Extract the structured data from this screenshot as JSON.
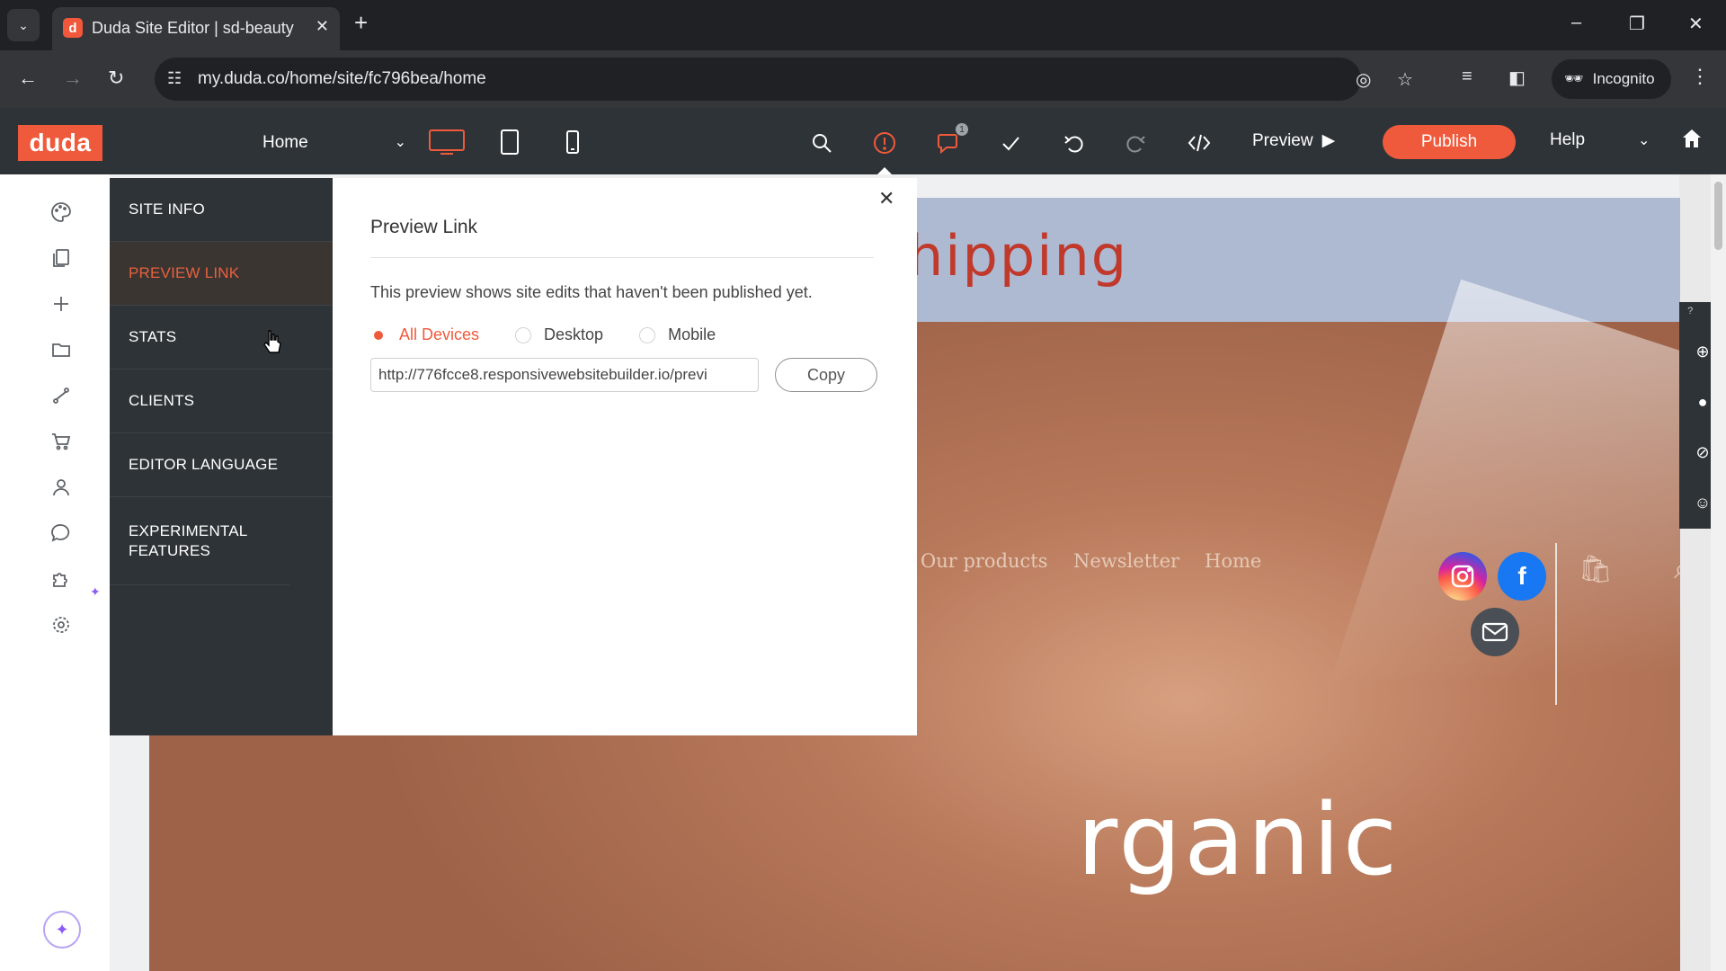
{
  "browser": {
    "tab_title": "Duda Site Editor | sd-beauty",
    "url": "my.duda.co/home/site/fc796bea/home",
    "profile_label": "Incognito"
  },
  "editor": {
    "page_selector": "Home",
    "preview_label": "Preview",
    "publish_label": "Publish",
    "help_label": "Help",
    "notification_count": "1",
    "accent_color": "#f05a3c"
  },
  "settings_menu": {
    "items": [
      {
        "label": "SITE INFO"
      },
      {
        "label": "PREVIEW LINK"
      },
      {
        "label": "STATS"
      },
      {
        "label": "CLIENTS"
      },
      {
        "label": "EDITOR LANGUAGE"
      },
      {
        "label": "EXPERIMENTAL FEATURES"
      }
    ],
    "active_item": "PREVIEW LINK"
  },
  "preview_panel": {
    "title": "Preview Link",
    "description": "This preview shows site edits that haven't been published yet.",
    "radio_options": [
      "All Devices",
      "Desktop",
      "Mobile"
    ],
    "selected_option": "All Devices",
    "link_value": "http://776fcce8.responsivewebsitebuilder.io/previ",
    "copy_label": "Copy"
  },
  "site": {
    "banner_text": "hipping",
    "nav_items": [
      "Our products",
      "Newsletter",
      "Home"
    ],
    "hero_text": "rganic"
  }
}
